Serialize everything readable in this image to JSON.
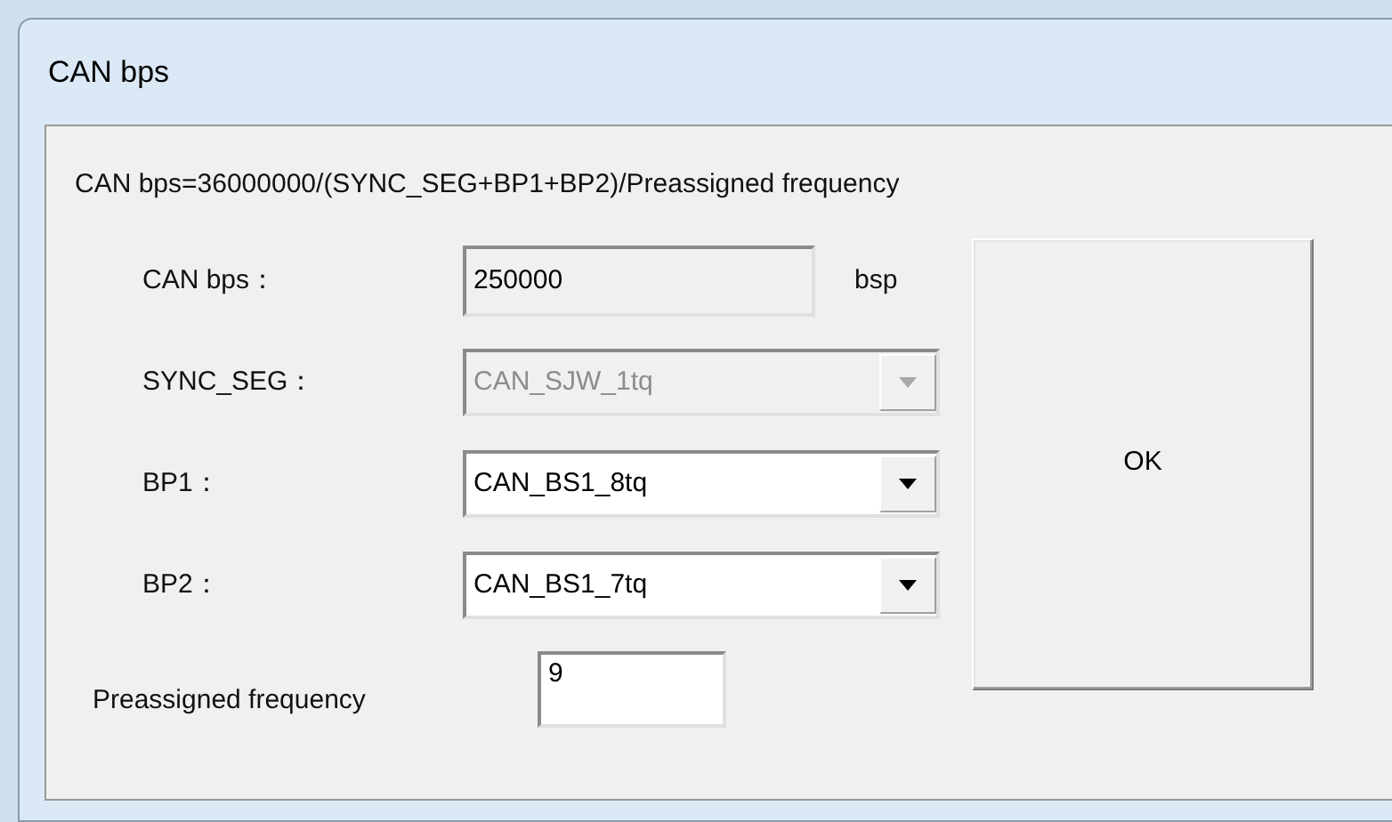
{
  "window": {
    "title": "CAN bps"
  },
  "formula": "CAN bps=36000000/(SYNC_SEG+BP1+BP2)/Preassigned frequency",
  "fields": [
    {
      "kind": "text",
      "label": "CAN bps：",
      "value": "250000",
      "unit": "bsp",
      "disabled": true
    },
    {
      "kind": "combo",
      "label": "SYNC_SEG：",
      "value": "CAN_SJW_1tq",
      "disabled": true
    },
    {
      "kind": "combo",
      "label": "BP1：",
      "value": "CAN_BS1_8tq",
      "disabled": false
    },
    {
      "kind": "combo",
      "label": "BP2：",
      "value": "CAN_BS1_7tq",
      "disabled": false
    }
  ],
  "frequency": {
    "label": "Preassigned frequency",
    "value": "9"
  },
  "ok_button": "OK"
}
